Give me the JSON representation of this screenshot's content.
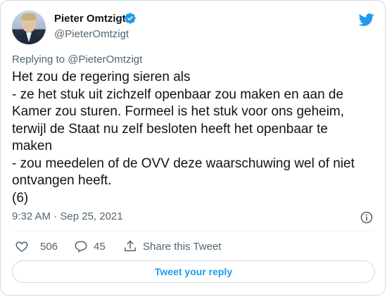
{
  "author": {
    "name": "Pieter Omtzigt",
    "handle": "@PieterOmtzigt"
  },
  "reply_context": {
    "prefix": "Replying to ",
    "handle": "@PieterOmtzigt"
  },
  "tweet": {
    "lines": [
      "Het zou de regering sieren als",
      "- ze het stuk uit zichzelf openbaar zou maken en aan de",
      "Kamer zou sturen. Formeel is het stuk voor ons geheim,",
      "terwijl de Staat nu zelf besloten heeft het openbaar te",
      "maken",
      "- zou meedelen of de OVV deze waarschuwing wel of niet",
      "ontvangen heeft.",
      "(6)"
    ],
    "timestamp": "9:32 AM · Sep 25, 2021"
  },
  "actions": {
    "likes": "506",
    "replies": "45",
    "share_label": "Share this Tweet"
  },
  "reply_button_label": "Tweet your reply",
  "colors": {
    "accent": "#1d9bf0",
    "secondary_text": "#536471",
    "border": "#cfd9de"
  },
  "icons": [
    "verified-badge-icon",
    "twitter-bird-icon",
    "info-icon",
    "heart-icon",
    "reply-icon",
    "share-icon"
  ]
}
